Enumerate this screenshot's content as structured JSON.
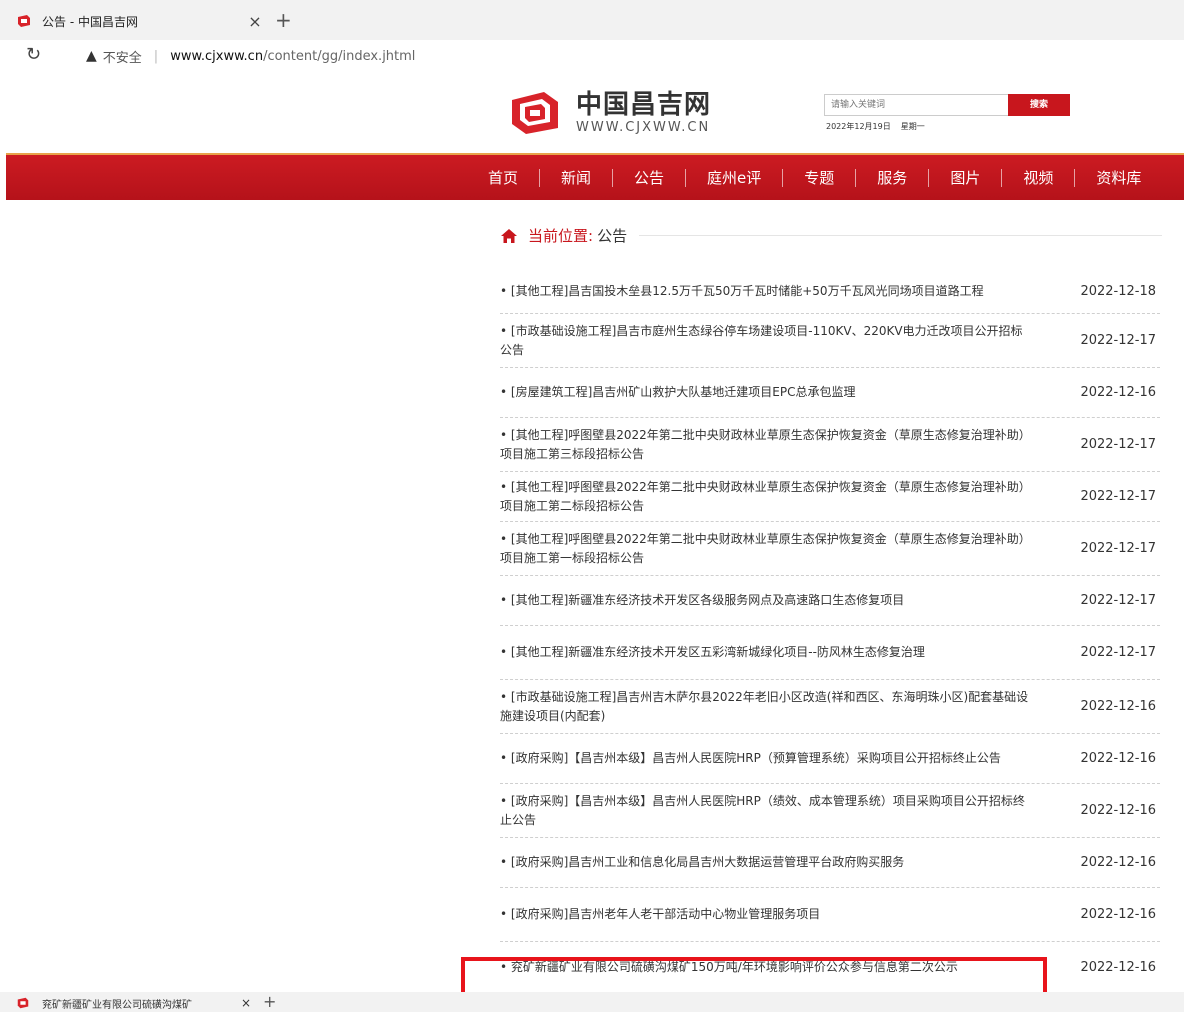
{
  "browser": {
    "tab_title": "公告 - 中国昌吉网",
    "tab_close": "×",
    "new_tab": "+",
    "security_label": "不安全",
    "url_host": "www.cjxww.cn",
    "url_path": "/content/gg/index.jhtml",
    "bottom_tab_title": "兖矿新疆矿业有限公司硫磺沟煤矿",
    "bottom_tab_close": "×",
    "bottom_new_tab": "+"
  },
  "site": {
    "logo_cn": "中国昌吉网",
    "logo_en": "WWW.CJXWW.CN",
    "search_placeholder": "请输入关键词",
    "search_button": "搜索",
    "date": "2022年12月19日",
    "weekday": "星期一",
    "brand_color": "#c8161d"
  },
  "nav": [
    "首页",
    "新闻",
    "公告",
    "庭州e评",
    "专题",
    "服务",
    "图片",
    "视频",
    "资料库"
  ],
  "breadcrumb": {
    "label": "当前位置:",
    "current": "公告"
  },
  "announcements": [
    {
      "title": "• [其他工程]昌吉国投木垒县12.5万千瓦50万千瓦时储能+50万千瓦风光同场项目道路工程",
      "date": "2022-12-18"
    },
    {
      "title": "• [市政基础设施工程]昌吉市庭州生态绿谷停车场建设项目-110KV、220KV电力迁改项目公开招标公告",
      "date": "2022-12-17"
    },
    {
      "title": "• [房屋建筑工程]昌吉州矿山救护大队基地迁建项目EPC总承包监理",
      "date": "2022-12-16"
    },
    {
      "title": "• [其他工程]呼图壁县2022年第二批中央财政林业草原生态保护恢复资金（草原生态修复治理补助）项目施工第三标段招标公告",
      "date": "2022-12-17"
    },
    {
      "title": "• [其他工程]呼图壁县2022年第二批中央财政林业草原生态保护恢复资金（草原生态修复治理补助）项目施工第二标段招标公告",
      "date": "2022-12-17"
    },
    {
      "title": "• [其他工程]呼图壁县2022年第二批中央财政林业草原生态保护恢复资金（草原生态修复治理补助）项目施工第一标段招标公告",
      "date": "2022-12-17"
    },
    {
      "title": "• [其他工程]新疆准东经济技术开发区各级服务网点及高速路口生态修复项目",
      "date": "2022-12-17"
    },
    {
      "title": "• [其他工程]新疆准东经济技术开发区五彩湾新城绿化项目--防风林生态修复治理",
      "date": "2022-12-17"
    },
    {
      "title": "• [市政基础设施工程]昌吉州吉木萨尔县2022年老旧小区改造(祥和西区、东海明珠小区)配套基础设施建设项目(内配套)",
      "date": "2022-12-16"
    },
    {
      "title": "• [政府采购]【昌吉州本级】昌吉州人民医院HRP（预算管理系统）采购项目公开招标终止公告",
      "date": "2022-12-16"
    },
    {
      "title": "• [政府采购]【昌吉州本级】昌吉州人民医院HRP（绩效、成本管理系统）项目采购项目公开招标终止公告",
      "date": "2022-12-16"
    },
    {
      "title": "• [政府采购]昌吉州工业和信息化局昌吉州大数据运营管理平台政府购买服务",
      "date": "2022-12-16"
    },
    {
      "title": "• [政府采购]昌吉州老年人老干部活动中心物业管理服务项目",
      "date": "2022-12-16"
    },
    {
      "title": "• 兖矿新疆矿业有限公司硫磺沟煤矿150万吨/年环境影响评价公众参与信息第二次公示",
      "date": "2022-12-16"
    }
  ]
}
